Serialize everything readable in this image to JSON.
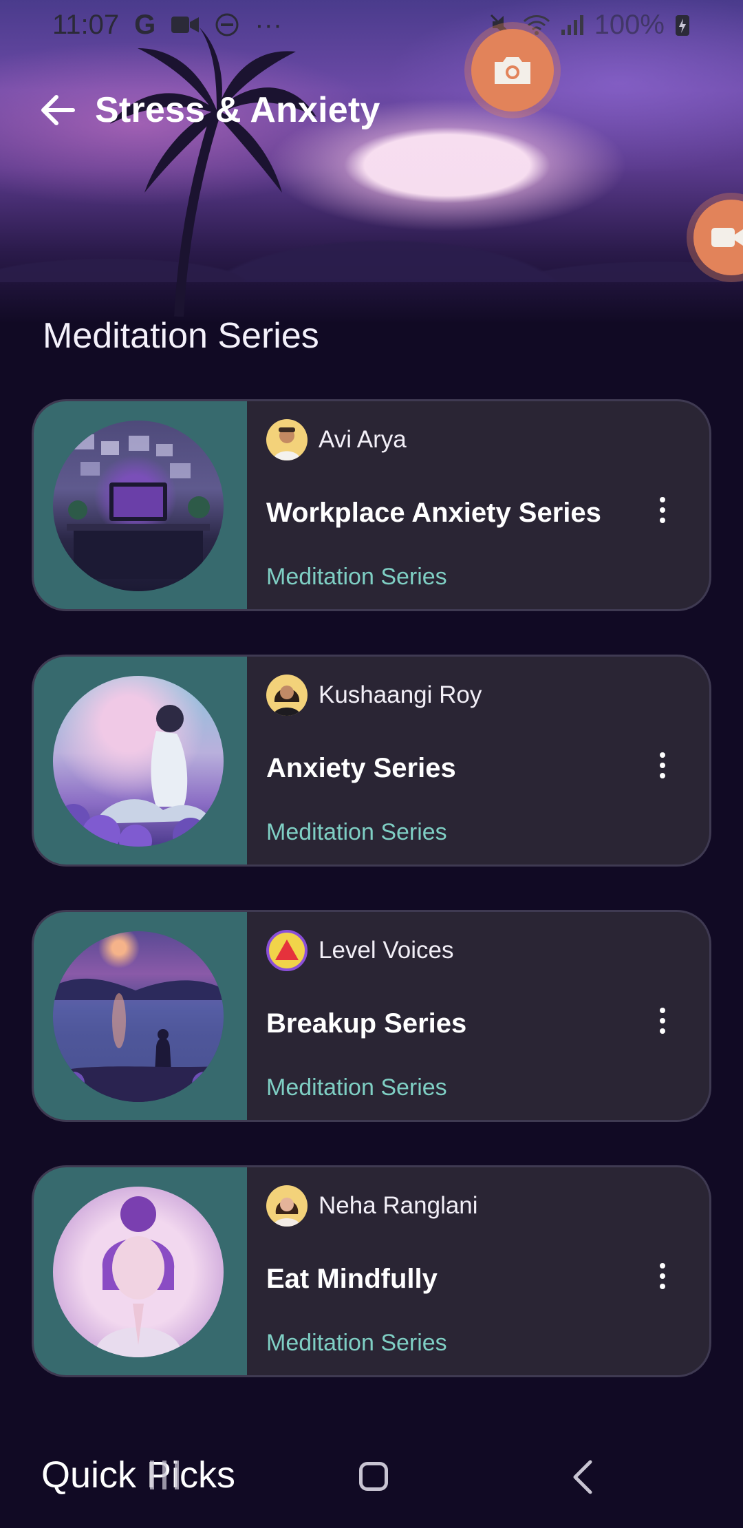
{
  "status_bar": {
    "time": "11:07",
    "g_icon": "G",
    "dots": "···",
    "battery_pct": "100%"
  },
  "header": {
    "title": "Stress & Anxiety"
  },
  "section": {
    "title": "Meditation Series"
  },
  "cards": [
    {
      "author": "Avi Arya",
      "title": "Workplace Anxiety Series",
      "subtitle": "Meditation Series"
    },
    {
      "author": "Kushaangi Roy",
      "title": "Anxiety Series",
      "subtitle": "Meditation Series"
    },
    {
      "author": "Level Voices",
      "title": "Breakup Series",
      "subtitle": "Meditation Series"
    },
    {
      "author": "Neha Ranglani",
      "title": "Eat Mindfully",
      "subtitle": "Meditation Series"
    }
  ],
  "bottom": {
    "quick_picks": "Quick Picks"
  },
  "icons": {
    "back": "arrow-left-icon",
    "more": "more-vertical-icon",
    "camera": "camera-icon",
    "video": "video-icon"
  },
  "colors": {
    "background": "#110a24",
    "card_bg": "#2a2534",
    "thumb_pane": "#376a6e",
    "subtitle": "#7fcfc4",
    "bubble": "#e2835a"
  }
}
